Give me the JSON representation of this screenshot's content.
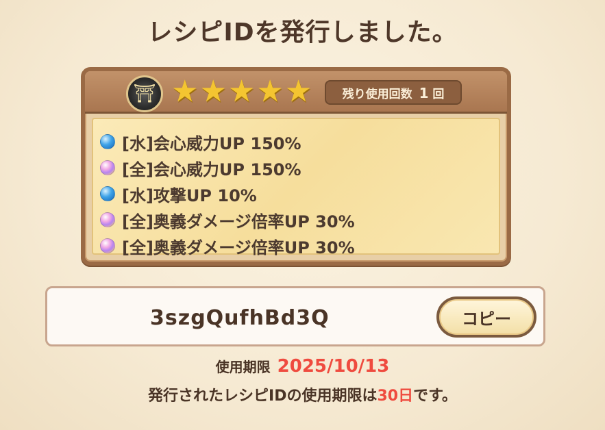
{
  "title": "レシピIDを発行しました。",
  "recipe": {
    "emblem_icon": "samurai-helmet-icon",
    "rarity_stars": 5,
    "uses_label": "残り使用回数",
    "uses_count": "1",
    "uses_unit": "回",
    "skills": [
      {
        "orb": "water",
        "text": "[水]会心威力UP 150%"
      },
      {
        "orb": "all",
        "text": "[全]会心威力UP 150%"
      },
      {
        "orb": "water",
        "text": "[水]攻撃UP 10%"
      },
      {
        "orb": "all",
        "text": "[全]奥義ダメージ倍率UP 30%"
      },
      {
        "orb": "all",
        "text": "[全]奥義ダメージ倍率UP 30%"
      }
    ]
  },
  "recipe_id": "3szgQufhBd3Q",
  "copy_button": "コピー",
  "expiry": {
    "label": "使用期限",
    "date": "2025/10/13"
  },
  "note": {
    "prefix": "発行されたレシピIDの使用期限は",
    "days": "30日",
    "suffix": "です。"
  },
  "colors": {
    "accent_red": "#ef4b3f",
    "star_gold": "#f4c531",
    "water_orb": "#3ea3e8"
  }
}
